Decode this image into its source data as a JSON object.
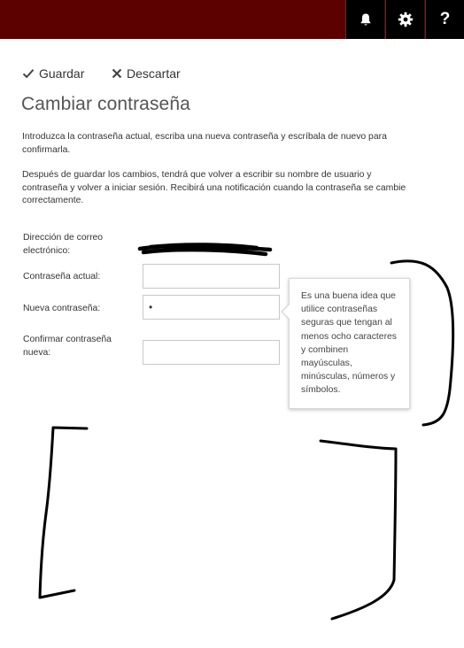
{
  "header": {
    "bell_icon": "bell-icon",
    "gear_icon": "gear-icon",
    "help_label": "?",
    "brand_color": "#5c0000"
  },
  "toolbar": {
    "save_label": "Guardar",
    "discard_label": "Descartar"
  },
  "page": {
    "title": "Cambiar contraseña",
    "intro": "Introduzca la contraseña actual, escriba una nueva contraseña y escríbala de nuevo para confirmarla.",
    "note": "Después de guardar los cambios, tendrá que volver a escribir su nombre de usuario y contraseña y volver a iniciar sesión. Recibirá una notificación cuando la contraseña se cambie correctamente."
  },
  "form": {
    "email_label": "Dirección de correo electrónico:",
    "current_label": "Contraseña actual:",
    "current_value": "",
    "new_label": "Nueva contraseña:",
    "new_value": "•",
    "confirm_label": "Confirmar contraseña nueva:",
    "confirm_value": ""
  },
  "tooltip": {
    "text": "Es una buena idea que utilice contraseñas seguras que tengan al menos ocho caracteres y combinen mayúsculas, minúsculas, números y símbolos."
  }
}
